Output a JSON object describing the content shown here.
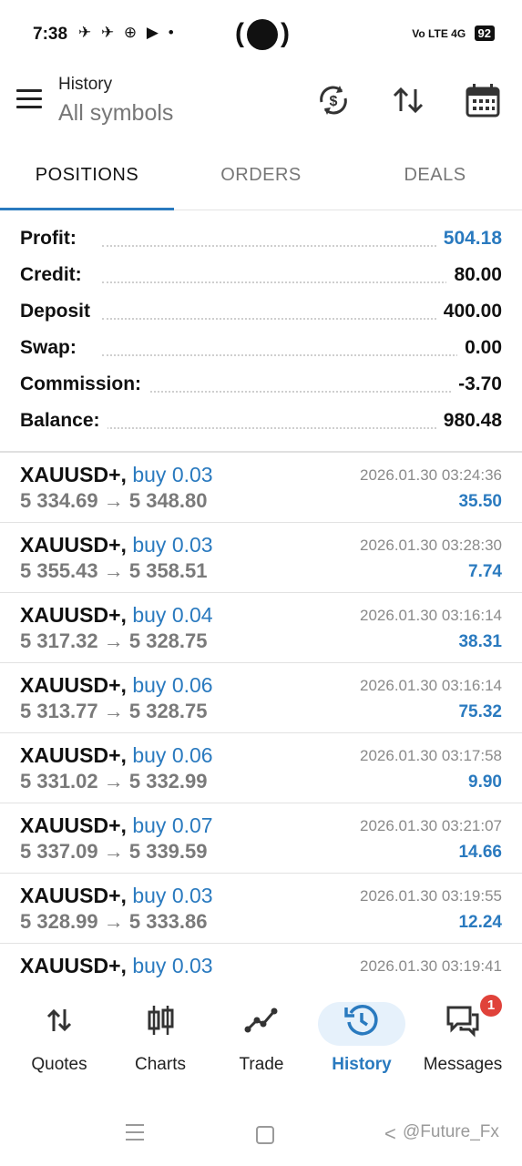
{
  "status": {
    "time": "7:38",
    "network": "Vo LTE 4G",
    "battery": "92"
  },
  "header": {
    "title": "History",
    "subtitle": "All symbols"
  },
  "tabs": [
    {
      "label": "POSITIONS"
    },
    {
      "label": "ORDERS"
    },
    {
      "label": "DEALS"
    }
  ],
  "summary": [
    {
      "label": "Profit:",
      "value": "504.18",
      "accent": true
    },
    {
      "label": "Credit:",
      "value": "80.00"
    },
    {
      "label": "Deposit",
      "value": "400.00"
    },
    {
      "label": "Swap:",
      "value": "0.00"
    },
    {
      "label": "Commission:",
      "value": "-3.70"
    },
    {
      "label": "Balance:",
      "value": "980.48"
    }
  ],
  "deals": [
    {
      "symbol": "XAUUSD+,",
      "side": "buy 0.03",
      "prices": "5 334.69 → 5 348.80",
      "time": "2026.01.30 03:24:36",
      "profit": "35.50"
    },
    {
      "symbol": "XAUUSD+,",
      "side": "buy 0.03",
      "prices": "5 355.43 → 5 358.51",
      "time": "2026.01.30 03:28:30",
      "profit": "7.74"
    },
    {
      "symbol": "XAUUSD+,",
      "side": "buy 0.04",
      "prices": "5 317.32 → 5 328.75",
      "time": "2026.01.30 03:16:14",
      "profit": "38.31"
    },
    {
      "symbol": "XAUUSD+,",
      "side": "buy 0.06",
      "prices": "5 313.77 → 5 328.75",
      "time": "2026.01.30 03:16:14",
      "profit": "75.32"
    },
    {
      "symbol": "XAUUSD+,",
      "side": "buy 0.06",
      "prices": "5 331.02 → 5 332.99",
      "time": "2026.01.30 03:17:58",
      "profit": "9.90"
    },
    {
      "symbol": "XAUUSD+,",
      "side": "buy 0.07",
      "prices": "5 337.09 → 5 339.59",
      "time": "2026.01.30 03:21:07",
      "profit": "14.66"
    },
    {
      "symbol": "XAUUSD+,",
      "side": "buy 0.03",
      "prices": "5 328.99 → 5 333.86",
      "time": "2026.01.30 03:19:55",
      "profit": "12.24"
    },
    {
      "symbol": "XAUUSD+,",
      "side": "buy 0.03",
      "prices": "",
      "time": "2026.01.30 03:19:41",
      "profit": ""
    }
  ],
  "nav": [
    {
      "label": "Quotes",
      "icon": "arrows-updown-icon"
    },
    {
      "label": "Charts",
      "icon": "candlestick-icon"
    },
    {
      "label": "Trade",
      "icon": "trend-line-icon"
    },
    {
      "label": "History",
      "icon": "history-clock-icon",
      "active": true
    },
    {
      "label": "Messages",
      "icon": "chat-bubbles-icon",
      "badge": "1"
    }
  ],
  "watermark": "@Future_Fx",
  "colors": {
    "accent": "#2a7abf",
    "badge": "#e0423a",
    "active_pill": "#e6f1fb"
  }
}
